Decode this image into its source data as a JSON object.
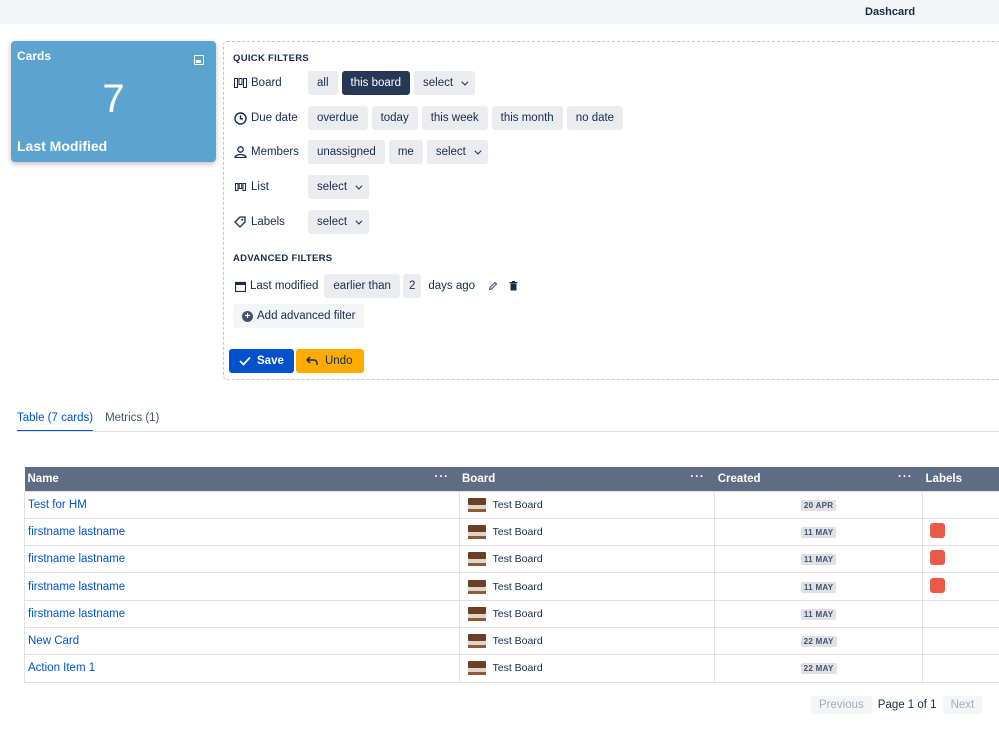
{
  "topbar": {
    "title": "Dashcard"
  },
  "stat_card": {
    "label": "Cards",
    "count": "7",
    "subtitle": "Last Modified",
    "icon": "image-icon"
  },
  "quick_filters": {
    "title": "QUICK FILTERS",
    "board": {
      "label": "Board",
      "icon": "board-icon",
      "options": [
        "all",
        "this board",
        "select"
      ],
      "active": "this board"
    },
    "due_date": {
      "label": "Due date",
      "icon": "clock-icon",
      "options": [
        "overdue",
        "today",
        "this week",
        "this month",
        "no date"
      ]
    },
    "members": {
      "label": "Members",
      "icon": "members-icon",
      "options": [
        "unassigned",
        "me",
        "select"
      ]
    },
    "list": {
      "label": "List",
      "icon": "list-icon",
      "options": [
        "select"
      ]
    },
    "labels": {
      "label": "Labels",
      "icon": "tag-icon",
      "options": [
        "select"
      ]
    }
  },
  "advanced_filters": {
    "title": "ADVANCED FILTERS",
    "last_modified": {
      "label": "Last modified",
      "icon": "calendar-icon",
      "operator": "earlier than",
      "value": "2",
      "unit": "days ago"
    },
    "add_label": "Add advanced filter"
  },
  "actions": {
    "save": "Save",
    "undo": "Undo"
  },
  "tabs": [
    {
      "label": "Table (7 cards)",
      "active": true
    },
    {
      "label": "Metrics (1)",
      "active": false
    }
  ],
  "table": {
    "columns": [
      "Name",
      "Board",
      "Created",
      "Labels"
    ],
    "rows": [
      {
        "name": "Test for HM",
        "board": "Test Board",
        "created": "20 APR",
        "label": false
      },
      {
        "name": "firstname lastname",
        "board": "Test Board",
        "created": "11 MAY",
        "label": true
      },
      {
        "name": "firstname lastname",
        "board": "Test Board",
        "created": "11 MAY",
        "label": true
      },
      {
        "name": "firstname lastname",
        "board": "Test Board",
        "created": "11 MAY",
        "label": true
      },
      {
        "name": "firstname lastname",
        "board": "Test Board",
        "created": "11 MAY",
        "label": false
      },
      {
        "name": "New Card",
        "board": "Test Board",
        "created": "22 MAY",
        "label": false
      },
      {
        "name": "Action Item 1",
        "board": "Test Board",
        "created": "22 MAY",
        "label": false
      }
    ],
    "label_color": "#eb5a46"
  },
  "pagination": {
    "previous": "Previous",
    "page_info": "Page 1 of 1",
    "next": "Next"
  },
  "colors": {
    "primary": "#0052cc",
    "warning": "#ffab00",
    "card_blue": "#5ba4cf",
    "header_bg": "#5e6c84"
  }
}
